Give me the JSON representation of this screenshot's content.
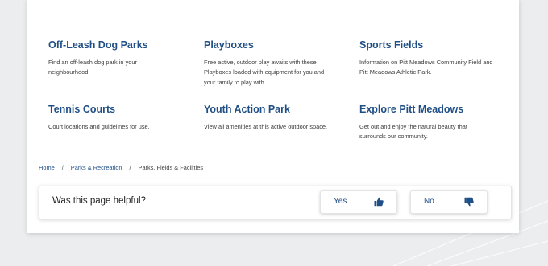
{
  "tiles": [
    {
      "title": "Off-Leash Dog Parks",
      "description": "Find an off-leash dog park in your neighbourhood!"
    },
    {
      "title": "Playboxes",
      "description": "Free active, outdoor play awaits with these Playboxes loaded with equipment for you and your family to play with."
    },
    {
      "title": "Sports Fields",
      "description": "Information on Pitt Meadows Community Field and Pitt Meadows Athletic Park."
    },
    {
      "title": "Tennis Courts",
      "description": "Court locations and guidelines for use."
    },
    {
      "title": "Youth Action Park",
      "description": "View all amenities at this active outdoor space."
    },
    {
      "title": "Explore Pitt Meadows",
      "description": "Get out and enjoy the natural beauty that surrounds our community."
    }
  ],
  "breadcrumb": {
    "home": "Home",
    "parks": "Parks & Recreation",
    "separator": "/",
    "current": "Parks, Fields & Facilities"
  },
  "feedback": {
    "question": "Was this page helpful?",
    "yes_label": "Yes",
    "no_label": "No",
    "yes_icon": "thumbs-up-icon",
    "no_icon": "thumbs-down-icon"
  },
  "colors": {
    "accent": "#1f4f86",
    "background": "#ecedef"
  }
}
